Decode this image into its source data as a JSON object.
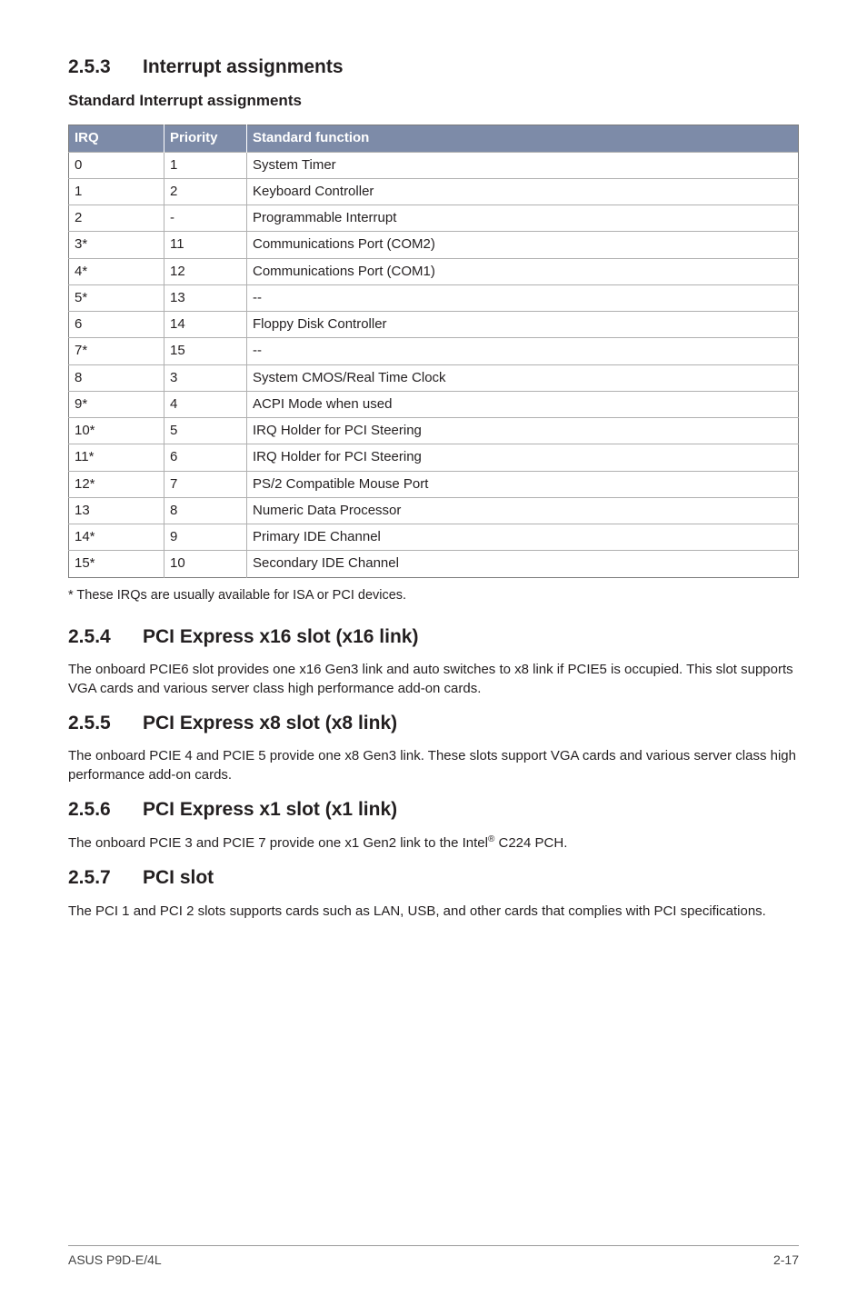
{
  "s253": {
    "num": "2.5.3",
    "title": "Interrupt assignments",
    "subhead": "Standard Interrupt assignments",
    "table": {
      "headers": {
        "irq": "IRQ",
        "priority": "Priority",
        "func": "Standard function"
      },
      "rows": [
        {
          "irq": "0",
          "priority": "1",
          "func": "System Timer"
        },
        {
          "irq": "1",
          "priority": "2",
          "func": "Keyboard Controller"
        },
        {
          "irq": "2",
          "priority": "-",
          "func": "Programmable Interrupt"
        },
        {
          "irq": "3*",
          "priority": "11",
          "func": "Communications Port (COM2)"
        },
        {
          "irq": "4*",
          "priority": "12",
          "func": "Communications Port (COM1)"
        },
        {
          "irq": "5*",
          "priority": "13",
          "func": "--"
        },
        {
          "irq": "6",
          "priority": "14",
          "func": "Floppy Disk Controller"
        },
        {
          "irq": "7*",
          "priority": "15",
          "func": "--"
        },
        {
          "irq": "8",
          "priority": "3",
          "func": "System CMOS/Real Time Clock"
        },
        {
          "irq": "9*",
          "priority": "4",
          "func": "ACPI Mode when used"
        },
        {
          "irq": "10*",
          "priority": "5",
          "func": "IRQ Holder for PCI Steering"
        },
        {
          "irq": "11*",
          "priority": "6",
          "func": "IRQ Holder for PCI Steering"
        },
        {
          "irq": "12*",
          "priority": "7",
          "func": "PS/2 Compatible Mouse Port"
        },
        {
          "irq": "13",
          "priority": "8",
          "func": "Numeric Data Processor"
        },
        {
          "irq": "14*",
          "priority": "9",
          "func": "Primary IDE Channel"
        },
        {
          "irq": "15*",
          "priority": "10",
          "func": "Secondary IDE Channel"
        }
      ]
    },
    "footnote": "* These IRQs are usually available for ISA or PCI devices."
  },
  "s254": {
    "num": "2.5.4",
    "title": "PCI Express x16 slot (x16 link)",
    "para": "The onboard PCIE6 slot provides one x16 Gen3 link and auto switches to x8 link if PCIE5 is occupied. This slot supports VGA cards and various server class high performance add-on cards."
  },
  "s255": {
    "num": "2.5.5",
    "title": "PCI Express x8 slot (x8 link)",
    "para": "The onboard PCIE 4 and PCIE 5 provide one x8 Gen3 link. These slots support VGA cards and various server class high performance add-on cards."
  },
  "s256": {
    "num": "2.5.6",
    "title": "PCI Express x1 slot (x1 link)",
    "para_pre": "The onboard PCIE 3 and PCIE 7 provide one x1 Gen2 link to the Intel",
    "para_sup": "®",
    "para_post": " C224 PCH."
  },
  "s257": {
    "num": "2.5.7",
    "title": "PCI slot",
    "para": "The PCI 1 and PCI 2 slots supports cards such as LAN, USB, and other cards that complies with PCI specifications."
  },
  "footer": {
    "left": "ASUS P9D-E/4L",
    "right": "2-17"
  }
}
